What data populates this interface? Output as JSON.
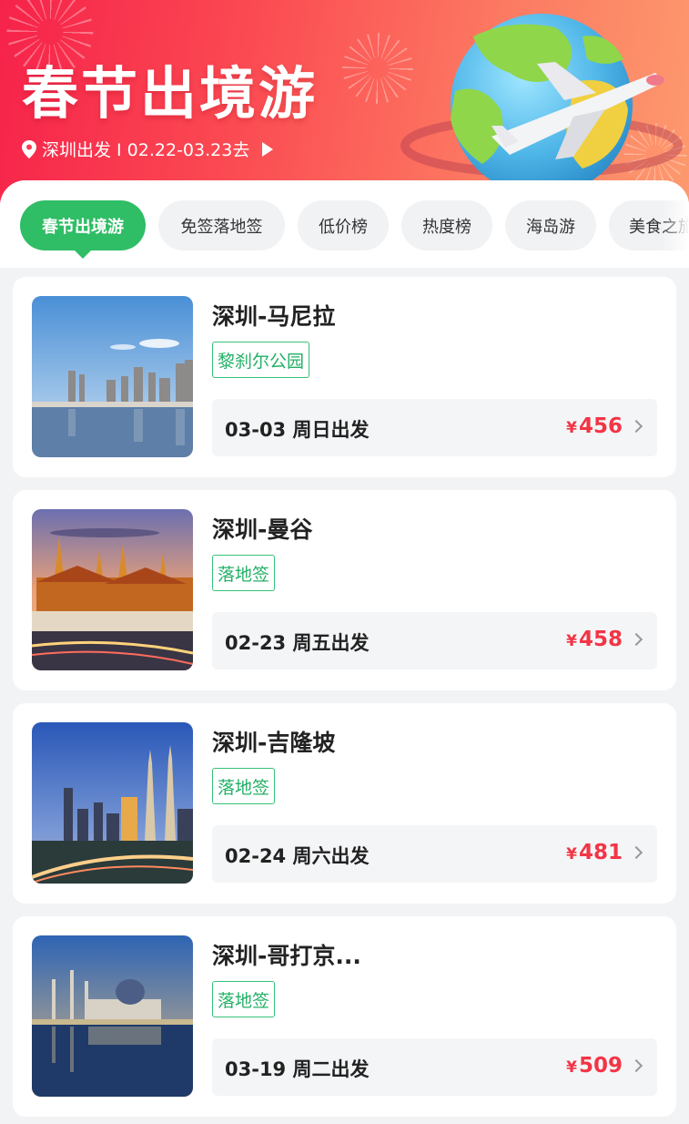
{
  "banner": {
    "title": "春节出境游",
    "subtitle": "深圳出发 I 02.22-03.23去",
    "icons": [
      "location-pin-icon",
      "play-arrow-icon",
      "globe-airplane-illustration"
    ]
  },
  "tabs": [
    {
      "label": "春节出境游",
      "active": true
    },
    {
      "label": "免签落地签",
      "active": false
    },
    {
      "label": "低价榜",
      "active": false
    },
    {
      "label": "热度榜",
      "active": false
    },
    {
      "label": "海岛游",
      "active": false
    },
    {
      "label": "美食之旅",
      "active": false
    }
  ],
  "cards": [
    {
      "route": "深圳-马尼拉",
      "tag": "黎刹尔公园",
      "date": "03-03 周日出发",
      "currency": "¥",
      "price": "456",
      "image": "manila-skyline-waterfront"
    },
    {
      "route": "深圳-曼谷",
      "tag": "落地签",
      "date": "02-23 周五出发",
      "currency": "¥",
      "price": "458",
      "image": "bangkok-grand-palace-dusk"
    },
    {
      "route": "深圳-吉隆坡",
      "tag": "落地签",
      "date": "02-24 周六出发",
      "currency": "¥",
      "price": "481",
      "image": "kuala-lumpur-petronas-towers"
    },
    {
      "route": "深圳-哥打京...",
      "tag": "落地签",
      "date": "03-19 周二出发",
      "currency": "¥",
      "price": "509",
      "image": "kota-kinabalu-floating-mosque"
    }
  ],
  "colors": {
    "banner_start": "#f6224a",
    "banner_end": "#fd9a6e",
    "tab_active": "#2fbd66",
    "tag_green": "#22b067",
    "price_red": "#f23545"
  }
}
